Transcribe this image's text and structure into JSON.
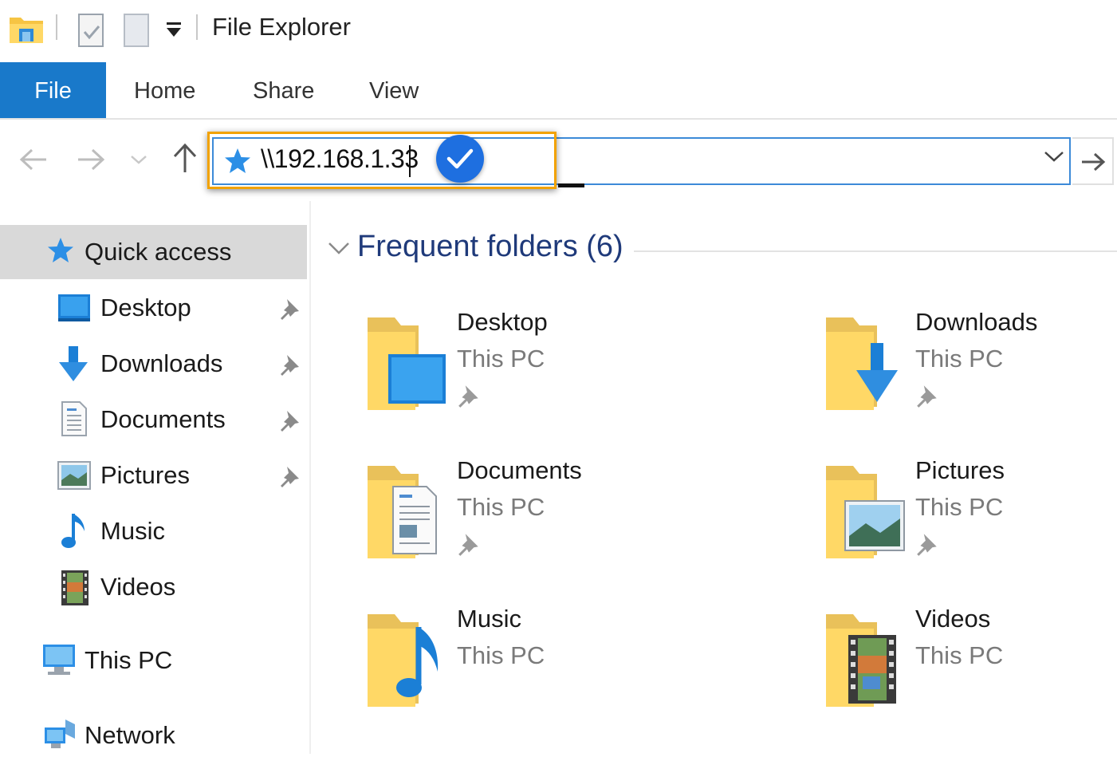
{
  "window": {
    "title": "File Explorer"
  },
  "ribbon": {
    "tabs": [
      {
        "label": "File"
      },
      {
        "label": "Home"
      },
      {
        "label": "Share"
      },
      {
        "label": "View"
      }
    ]
  },
  "address_bar": {
    "value": "\\\\192.168.1.33"
  },
  "navigation_pane": {
    "quick_access": "Quick access",
    "items": [
      {
        "label": "Desktop",
        "pinned": true
      },
      {
        "label": "Downloads",
        "pinned": true
      },
      {
        "label": "Documents",
        "pinned": true
      },
      {
        "label": "Pictures",
        "pinned": true
      },
      {
        "label": "Music",
        "pinned": false
      },
      {
        "label": "Videos",
        "pinned": false
      }
    ],
    "this_pc": "This PC",
    "network": "Network"
  },
  "content": {
    "section_title": "Frequent folders (6)",
    "folders": [
      {
        "name": "Desktop",
        "location": "This PC",
        "pinned": true
      },
      {
        "name": "Downloads",
        "location": "This PC",
        "pinned": true
      },
      {
        "name": "Documents",
        "location": "This PC",
        "pinned": true
      },
      {
        "name": "Pictures",
        "location": "This PC",
        "pinned": true
      },
      {
        "name": "Music",
        "location": "This PC",
        "pinned": false
      },
      {
        "name": "Videos",
        "location": "This PC",
        "pinned": false
      }
    ]
  },
  "colors": {
    "file_tab": "#1979ca",
    "address_highlight": "#f2a200",
    "section_title": "#1f3a7a",
    "check_badge": "#1e6fe0"
  }
}
